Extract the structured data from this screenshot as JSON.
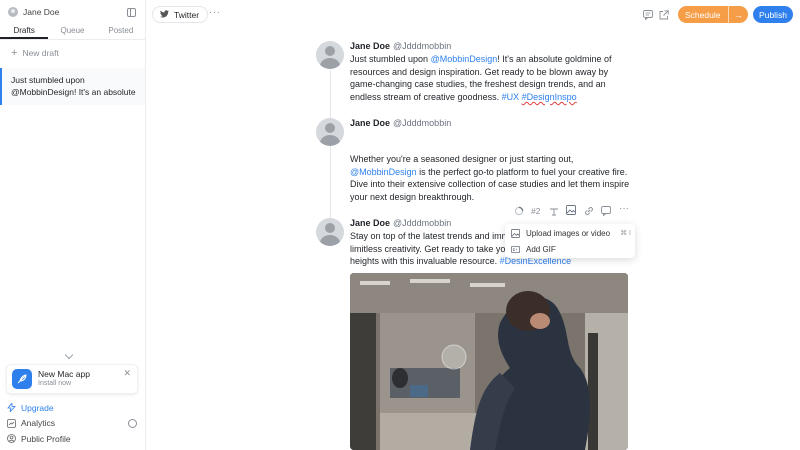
{
  "sidebar": {
    "user_name": "Jane Doe",
    "tabs": [
      {
        "label": "Drafts",
        "active": true
      },
      {
        "label": "Queue",
        "active": false
      },
      {
        "label": "Posted",
        "active": false
      }
    ],
    "new_draft_label": "New draft",
    "drafts": [
      {
        "text": "Just stumbled upon @MobbinDesign! It's an absolute"
      }
    ],
    "promo": {
      "title": "New Mac app",
      "subtitle": "Install now"
    },
    "links": [
      {
        "label": "Upgrade",
        "icon": "bolt-icon"
      },
      {
        "label": "Analytics",
        "icon": "chart-icon"
      },
      {
        "label": "Public Profile",
        "icon": "user-circle-icon"
      }
    ]
  },
  "topbar": {
    "account_label": "Twitter",
    "schedule_label": "Schedule",
    "publish_label": "Publish",
    "colors": {
      "schedule": "#f59e47",
      "publish": "#2f80ed"
    }
  },
  "thread": {
    "tweets": [
      {
        "name": "Jane Doe",
        "handle": "@Jdddmobbin",
        "body_parts": [
          {
            "text": "Just stumbled upon ",
            "type": "text"
          },
          {
            "text": "@MobbinDesign",
            "type": "link"
          },
          {
            "text": "! It's an absolute goldmine of resources and design inspiration. Get ready to be blown away by game-changing case studies, the freshest design trends, and an endless stream of creative goodness. ",
            "type": "text"
          },
          {
            "text": "#UX",
            "type": "link"
          },
          {
            "text": " ",
            "type": "text"
          },
          {
            "text": "#DesignInspo",
            "type": "link-underline"
          }
        ]
      },
      {
        "name": "Jane Doe",
        "handle": "@Jdddmobbin",
        "body_parts": [
          {
            "text": "Whether you're a seasoned designer or just starting out, ",
            "type": "text"
          },
          {
            "text": "@MobbinDesign",
            "type": "link"
          },
          {
            "text": " is the perfect go-to platform to fuel your creative fire. Dive into their extensive collection of case studies and let them inspire your next design breakthrough.",
            "type": "text"
          }
        ]
      },
      {
        "name": "Jane Doe",
        "handle": "@Jdddmobbin",
        "body_parts": [
          {
            "text": "Stay on top of the latest trends and imme",
            "type": "text"
          },
          {
            "text": "limitless creativity. Get ready to take you",
            "type": "text"
          },
          {
            "text": "heights with this invaluable resource. ",
            "type": "text"
          },
          {
            "text": "#Desi",
            "type": "link"
          },
          {
            "text": "nExcellence",
            "type": "link"
          }
        ],
        "thread_number": "#2"
      }
    ],
    "media_menu": [
      {
        "label": "Upload images or video",
        "icon": "image-icon",
        "shortcut": "⌘ I"
      },
      {
        "label": "Add GIF",
        "icon": "gif-icon",
        "shortcut": ""
      }
    ]
  }
}
